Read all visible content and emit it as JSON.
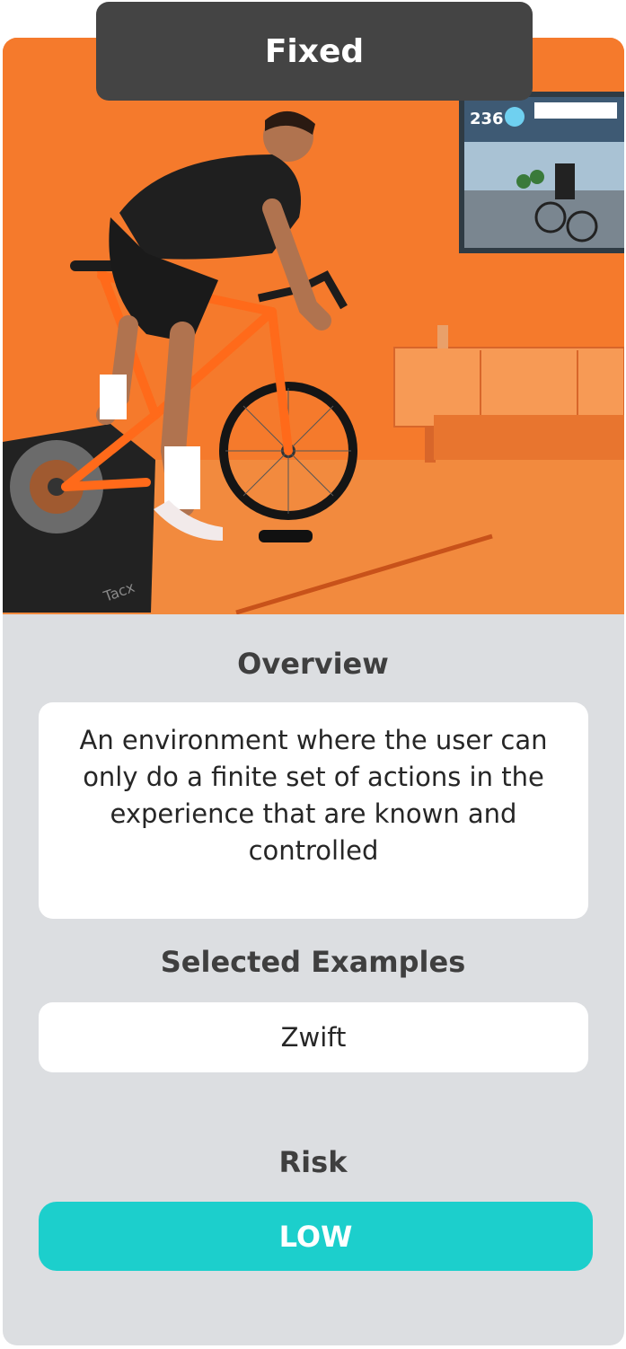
{
  "header": {
    "title": "Fixed"
  },
  "hero": {
    "tv_stat": "236"
  },
  "overview": {
    "heading": "Overview",
    "text": "An environment where the user can only do a finite set of actions in the experience that are known and controlled"
  },
  "examples": {
    "heading": "Selected Examples",
    "items": [
      "Zwift"
    ]
  },
  "risk": {
    "heading": "Risk",
    "level": "LOW",
    "color": "#1ccfcc"
  },
  "colors": {
    "tab_bg": "#444444",
    "card_bg": "#dcdee1",
    "photo_bg": "#f57c2e"
  }
}
